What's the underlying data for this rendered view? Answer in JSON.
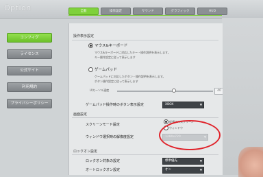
{
  "app_title": "Option",
  "tabs": [
    {
      "label": "全般",
      "active": true
    },
    {
      "label": "操作設定",
      "active": false
    },
    {
      "label": "サウンド",
      "active": false
    },
    {
      "label": "グラフィック",
      "active": false
    },
    {
      "label": "HUD",
      "active": false
    }
  ],
  "sidebar": [
    {
      "label": "コンフィグ",
      "active": true
    },
    {
      "label": "ライセンス",
      "active": false
    },
    {
      "label": "公式サイト",
      "active": false
    },
    {
      "label": "利用規約",
      "active": false
    },
    {
      "label": "プライバシーポリシー",
      "active": false
    }
  ],
  "control": {
    "section": "操作表示設定",
    "keyboard": {
      "label": "マウス&キーボード",
      "desc1": "マウス&キーボードに対応したキー・操作説明を表示します。",
      "desc2": "キー操作設定に従って表示します"
    },
    "gamepad": {
      "label": "ゲームパッド",
      "desc1": "ゲームパッドに対応したボタン・操作説明を表示します。",
      "desc2": "ボタン操作設定に従って表示します"
    },
    "slider_label": "UIカーソル速度",
    "slider_value": "40",
    "button_display_label": "ゲームパッド操作時のボタン表示設定",
    "button_display_value": "XBOX"
  },
  "screen": {
    "section": "画面設定",
    "mode_label": "スクリーンモード設定",
    "mode_fullscreen": "仮想フルスクリーン",
    "mode_window": "ウィンドウ",
    "resolution_label": "ウィンドウ選択時の解像度設定",
    "resolution_value": "1280x720"
  },
  "lockon": {
    "section": "ロックオン設定",
    "target_label": "ロックオン対象の設定",
    "target_value": "標準優先",
    "auto_label": "オートロックオン設定",
    "auto_value": "オン"
  }
}
